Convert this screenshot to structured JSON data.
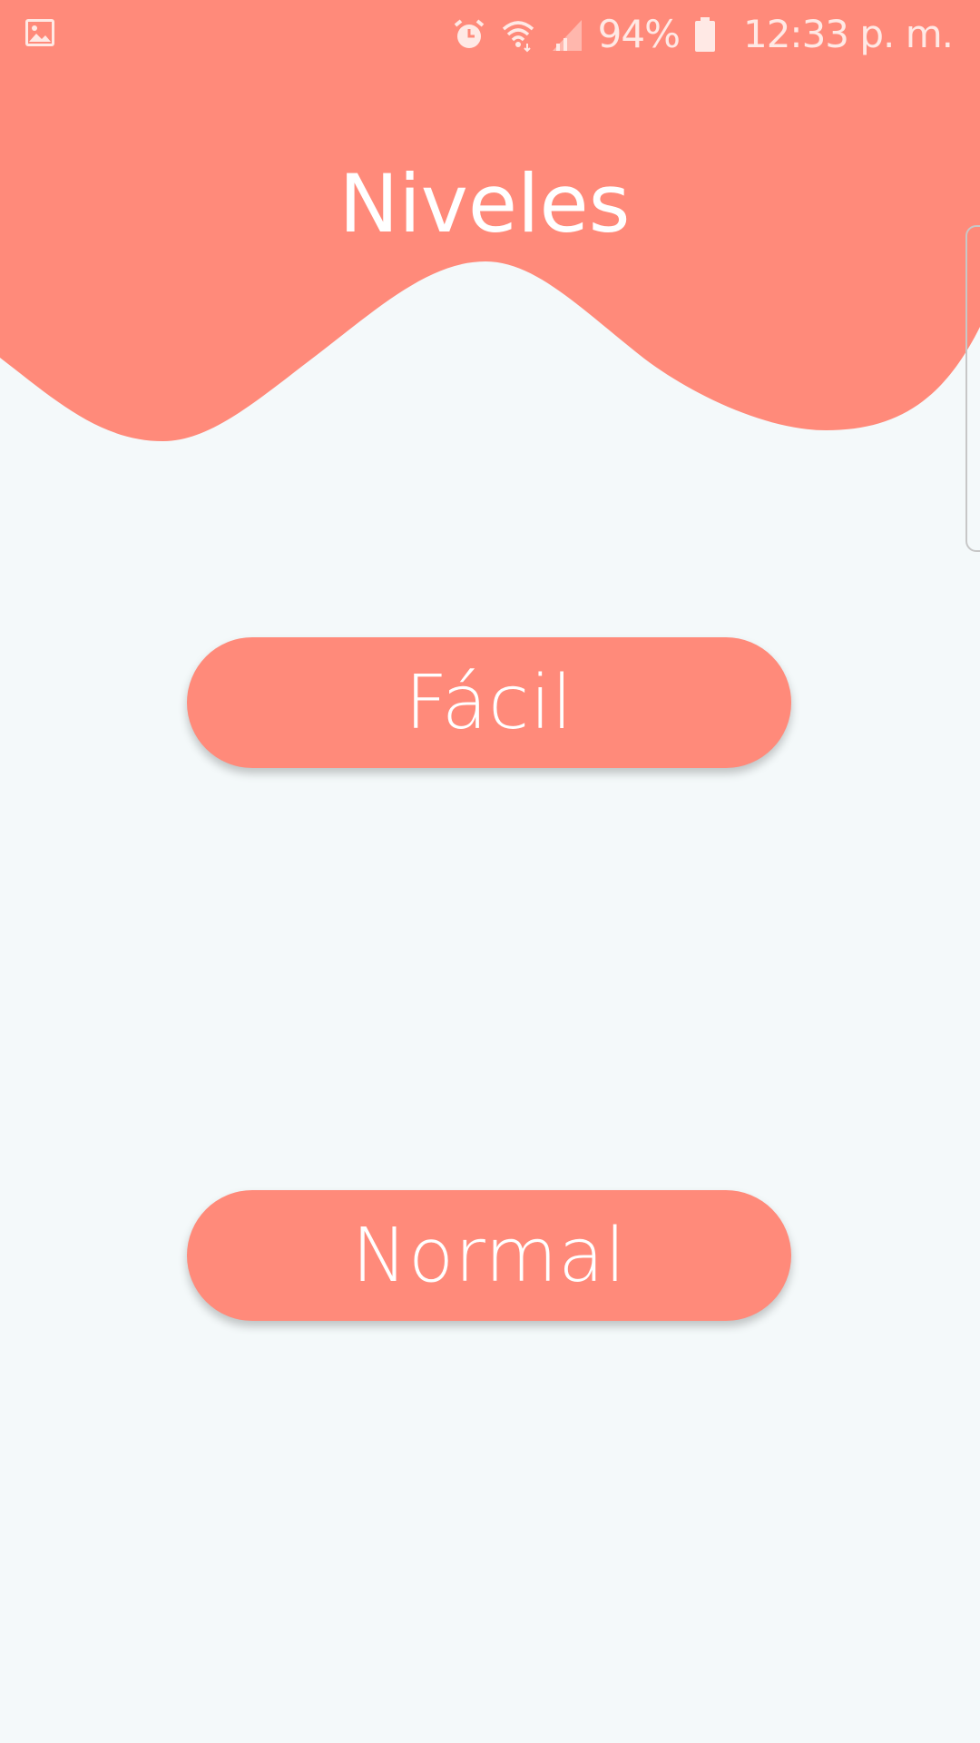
{
  "status_bar": {
    "left_icon": "image-icon",
    "icons": [
      "alarm-icon",
      "wifi-icon",
      "signal-icon"
    ],
    "battery_percent": "94%",
    "battery_icon": "battery-icon",
    "time": "12:33 p. m."
  },
  "header": {
    "title": "Niveles"
  },
  "levels": {
    "easy_label": "Fácil",
    "normal_label": "Normal"
  },
  "colors": {
    "accent": "#ff8a7a",
    "background": "#f4f9fa",
    "text_on_accent": "#ffffff"
  }
}
